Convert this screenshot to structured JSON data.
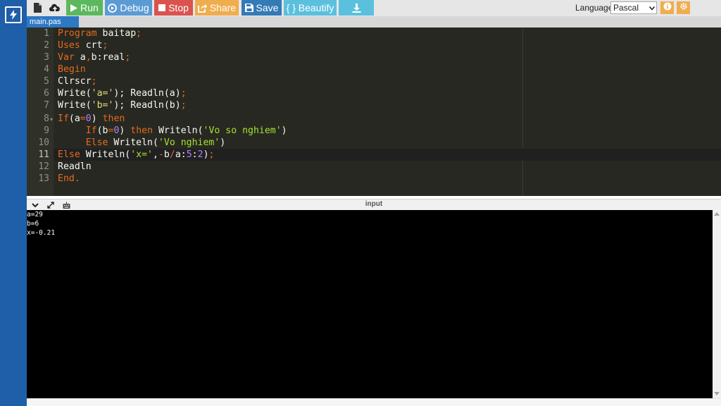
{
  "toolbar": {
    "run_label": "Run",
    "debug_label": "Debug",
    "stop_label": "Stop",
    "share_label": "Share",
    "save_label": "Save",
    "beautify_label": "{ } Beautify",
    "language_label": "Language",
    "language_value": "Pascal"
  },
  "tab": {
    "filename": "main.pas"
  },
  "editor": {
    "line_numbers": [
      "1",
      "2",
      "3",
      "4",
      "5",
      "6",
      "7",
      "8",
      "9",
      "10",
      "11",
      "12",
      "13"
    ],
    "active_line": 11,
    "tokens": {
      "l1_kw": "Program",
      "l1_id": " baitap",
      "l1_p": ";",
      "l2_kw": "Uses",
      "l2_id": " crt",
      "l2_p": ";",
      "l3_kw": "Var",
      "l3_id": " a",
      "l3_c": ",",
      "l3_id2": "b:real",
      "l3_p": ";",
      "l4_kw": "Begin",
      "l5_id": "Clrscr",
      "l5_p": ";",
      "l6_a": "Write(",
      "l6_s": "'a='",
      "l6_b": "); ",
      "l6_c": "Readln(a)",
      "l6_p": ";",
      "l7_a": "Write(",
      "l7_s": "'b='",
      "l7_b": "); ",
      "l7_c": "Readln(b)",
      "l7_p": ";",
      "l8_kw": "If",
      "l8_a": "(a",
      "l8_op": "=",
      "l8_n": "0",
      "l8_b": ") ",
      "l8_kw2": "then",
      "l9_ind": "     ",
      "l9_kw": "If",
      "l9_a": "(b",
      "l9_op": "=",
      "l9_n": "0",
      "l9_b": ") ",
      "l9_kw2": "then",
      "l9_c": " Writeln(",
      "l9_s": "'Vo so nghiem'",
      "l9_d": ")",
      "l10_ind": "     ",
      "l10_kw": "Else",
      "l10_c": " Writeln(",
      "l10_s": "'Vo nghiem'",
      "l10_d": ")",
      "l11_kw": "Else",
      "l11_c": " Writeln(",
      "l11_s": "'x='",
      "l11_d": ",",
      "l11_op": "-",
      "l11_e": "b",
      "l11_op2": "/",
      "l11_f": "a:",
      "l11_n": "5",
      "l11_g": ":",
      "l11_n2": "2",
      "l11_h": ")",
      "l11_p": ";",
      "l12_id": "Readln",
      "l13_kw": "End",
      "l13_p": "."
    }
  },
  "input_panel": {
    "title": "input"
  },
  "terminal": {
    "lines": [
      "a=29",
      "b=6",
      "x=-0.21"
    ]
  },
  "colors": {
    "sidebar": "#1f5ea8",
    "run": "#5cb85c",
    "debug": "#5b9bd5",
    "stop": "#d9534f",
    "share": "#f0ad4e",
    "save": "#337ab7",
    "beautify": "#5bc0de",
    "editor_bg": "#272822"
  },
  "icons": [
    "bolt-icon",
    "new-file-icon",
    "upload-icon",
    "play-icon",
    "debug-icon",
    "stop-icon",
    "share-icon",
    "save-icon",
    "download-icon",
    "info-icon",
    "gear-icon",
    "collapse-icon",
    "expand-icon",
    "keyboard-icon"
  ]
}
